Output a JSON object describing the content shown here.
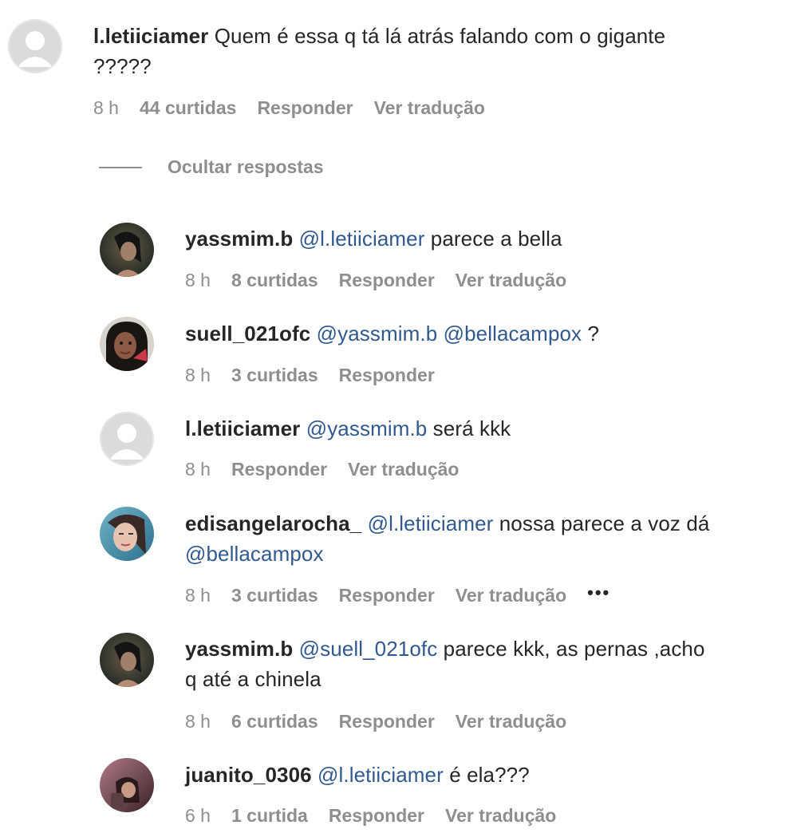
{
  "main_comment": {
    "username": "l.letiiciamer",
    "text_line1": " Quem é essa q tá lá atrás falando com o gigante",
    "text_line2": "?????",
    "time": "8 h",
    "likes": "44 curtidas",
    "reply": "Responder",
    "translate": "Ver tradução"
  },
  "hide_replies": {
    "label": "Ocultar respostas"
  },
  "replies": [
    {
      "username": "yassmim.b",
      "mention": "@l.letiiciamer",
      "text": " parece a bella",
      "time": "8 h",
      "likes": "8 curtidas",
      "reply": "Responder",
      "translate": "Ver tradução"
    },
    {
      "username": "suell_021ofc",
      "mention": "@yassmim.b",
      "mention2": "@bellacampox",
      "text": " ?",
      "time": "8 h",
      "likes": "3 curtidas",
      "reply": "Responder"
    },
    {
      "username": "l.letiiciamer",
      "mention": "@yassmim.b",
      "text": " será kkk",
      "time": "8 h",
      "reply": "Responder",
      "translate": "Ver tradução"
    },
    {
      "username": "edisangelarocha_",
      "mention": "@l.letiiciamer",
      "text": " nossa parece a voz dá",
      "mention2": "@bellacampox",
      "time": "8 h",
      "likes": "3 curtidas",
      "reply": "Responder",
      "translate": "Ver tradução",
      "more": "•••"
    },
    {
      "username": "yassmim.b",
      "mention": "@suell_021ofc",
      "text": " parece kkk, as pernas ,acho",
      "text_line2": "q até a chinela",
      "time": "8 h",
      "likes": "6 curtidas",
      "reply": "Responder",
      "translate": "Ver tradução"
    },
    {
      "username": "juanito_0306",
      "mention": "@l.letiiciamer",
      "text": " é ela???",
      "time": "6 h",
      "likes": "1 curtida",
      "reply": "Responder",
      "translate": "Ver tradução"
    }
  ],
  "colors": {
    "text": "#262626",
    "muted": "#8e8e8e",
    "mention": "#305a8f",
    "default_avatar_bg": "#dbdbdb"
  }
}
